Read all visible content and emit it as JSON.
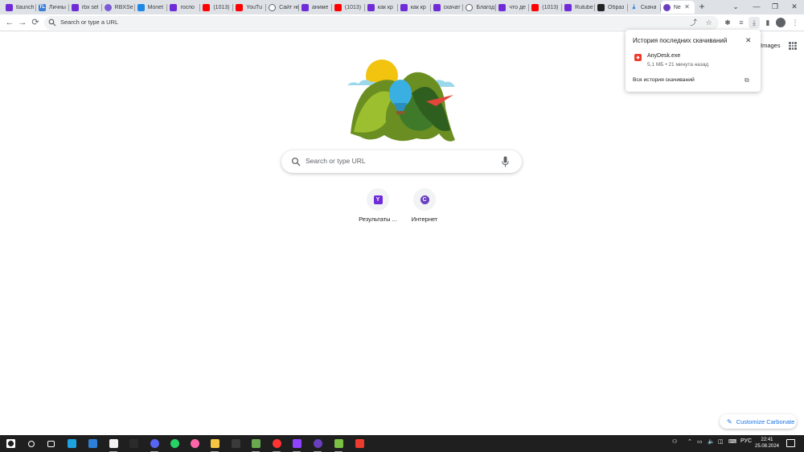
{
  "tabs": [
    {
      "title": "tlaunch",
      "icon": "yandex"
    },
    {
      "title": "Личны",
      "icon": "tl"
    },
    {
      "title": "rbx sel",
      "icon": "yandex"
    },
    {
      "title": "RBXSe",
      "icon": "roblox"
    },
    {
      "title": "Monet",
      "icon": "monetka"
    },
    {
      "title": "госпо",
      "icon": "yandex"
    },
    {
      "title": "(1013)",
      "icon": "youtube"
    },
    {
      "title": "YouTu",
      "icon": "youtube"
    },
    {
      "title": "Сайт не за",
      "icon": "globe"
    },
    {
      "title": "аниме",
      "icon": "yandex"
    },
    {
      "title": "(1013)",
      "icon": "youtube"
    },
    {
      "title": "как кр",
      "icon": "yandex"
    },
    {
      "title": "как кр",
      "icon": "yandex"
    },
    {
      "title": "скачат",
      "icon": "yandex"
    },
    {
      "title": "Благод",
      "icon": "globe"
    },
    {
      "title": "что де",
      "icon": "yandex"
    },
    {
      "title": "(1013)",
      "icon": "youtube"
    },
    {
      "title": "Rutube",
      "icon": "yandex"
    },
    {
      "title": "Образ",
      "icon": "fb"
    },
    {
      "title": "Скача",
      "icon": "download"
    },
    {
      "title": "Ne",
      "icon": "carbonate",
      "active": true
    }
  ],
  "window_controls": {
    "dropdown": "⌄",
    "minimize": "—",
    "maximize": "❐",
    "close": "✕"
  },
  "toolbar": {
    "back": "←",
    "forward": "→",
    "reload": "⟳",
    "omnibox_placeholder": "Search or type a URL",
    "share": "⤴",
    "star": "☆",
    "extensions": "✱",
    "downloads": "⤓",
    "reading_list": "≡",
    "side_panel": "▮",
    "menu": "⋮"
  },
  "ntp": {
    "images_link": "Images",
    "search_placeholder": "Search or type URL",
    "shortcuts": [
      {
        "label": "Результаты ...",
        "icon": "yandex",
        "glyph": "Y"
      },
      {
        "label": "Интернет",
        "icon": "carbonate",
        "glyph": "C"
      }
    ],
    "customize": "Customize Carbonate",
    "customize_icon": "pencil-icon"
  },
  "downloads_bubble": {
    "title": "История последних скачиваний",
    "close": "✕",
    "items": [
      {
        "name": "AnyDesk.exe",
        "meta": "5,1 МБ • 21 минута назад"
      }
    ],
    "all_link": "Вся история скачиваний",
    "external": "⧉"
  },
  "taskbar": {
    "apps": [
      {
        "name": "start",
        "color": "#ffffff"
      },
      {
        "name": "search",
        "color": "#ffffff"
      },
      {
        "name": "task-view",
        "color": "#ffffff"
      },
      {
        "name": "edge",
        "color": "#1fa2e0"
      },
      {
        "name": "mail",
        "color": "#2d7fd8"
      },
      {
        "name": "store",
        "color": "#f2f2f2"
      },
      {
        "name": "epic",
        "color": "#2b2b2b"
      },
      {
        "name": "discord",
        "color": "#5865f2"
      },
      {
        "name": "whatsapp",
        "color": "#25d366"
      },
      {
        "name": "osu",
        "color": "#ff66aa"
      },
      {
        "name": "explorer",
        "color": "#f4c542"
      },
      {
        "name": "blank",
        "color": "#3a3a3a"
      },
      {
        "name": "minecraft",
        "color": "#6aa84f"
      },
      {
        "name": "yandex",
        "color": "#ff3333"
      },
      {
        "name": "crosshair",
        "color": "#8e44ff"
      },
      {
        "name": "carbonate",
        "color": "#6a3fbf"
      },
      {
        "name": "block",
        "color": "#7bc043"
      },
      {
        "name": "anydesk",
        "color": "#ef3b2d"
      }
    ],
    "tray_language": "РУС",
    "time": "22:41",
    "date": "25.08.2024"
  }
}
